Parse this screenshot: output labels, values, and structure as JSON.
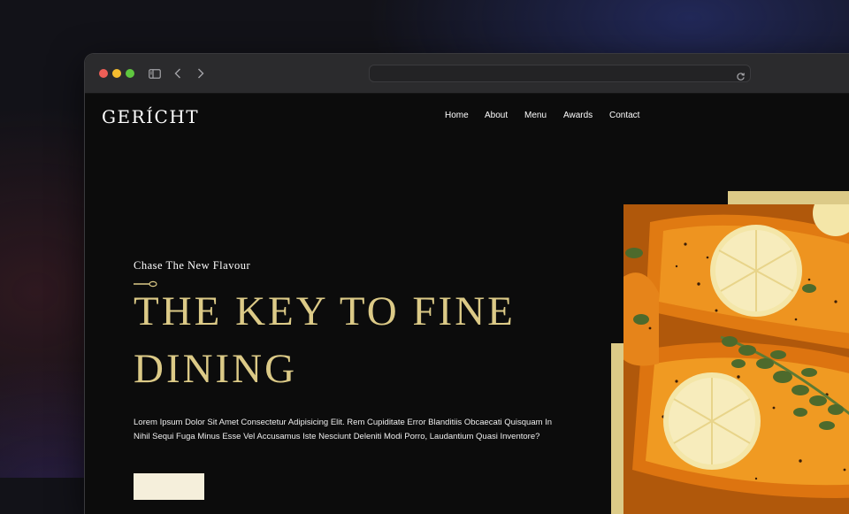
{
  "browser": {
    "url": "",
    "icons": [
      "close-dot",
      "minimize-dot",
      "maximize-dot",
      "sidebar-icon",
      "back-arrow-icon",
      "forward-arrow-icon",
      "reload-icon"
    ]
  },
  "site": {
    "logo": "GERÍCHT",
    "nav": [
      "Home",
      "About",
      "Menu",
      "Awards",
      "Contact"
    ],
    "hero": {
      "subtitle": "Chase The New Flavour",
      "headline_line1": "THE KEY TO FINE",
      "headline_line2": "DINING",
      "paragraph": "Lorem Ipsum Dolor Sit Amet Consectetur Adipisicing Elit. Rem Cupiditate Error Blanditiis Obcaecati Quisquam In Nihil Sequi Fuga Minus Esse Vel Accusamus Iste Nesciunt Deleniti Modi Porro, Laudantium Quasi Inventore?",
      "button_label": ""
    }
  },
  "colors": {
    "gold": "#dcca87",
    "background": "#0c0c0c",
    "text": "#ffffff",
    "titlebar": "#2b2b2d"
  }
}
